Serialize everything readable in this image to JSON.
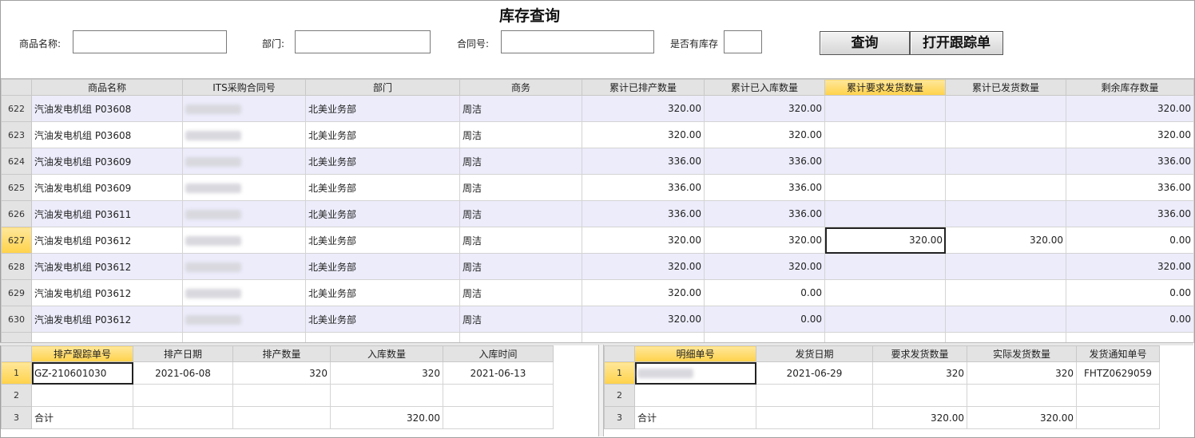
{
  "title": "库存查询",
  "form": {
    "product_label": "商品名称:",
    "product_value": "",
    "dept_label": "部门:",
    "dept_value": "",
    "contract_label": "合同号:",
    "contract_value": "",
    "stock_label": "是否有库存",
    "stock_value": ""
  },
  "buttons": {
    "query": "查询",
    "open_tracking": "打开跟踪单"
  },
  "main": {
    "headers": [
      "商品名称",
      "ITS采购合同号",
      "部门",
      "商务",
      "累计已排产数量",
      "累计已入库数量",
      "累计要求发货数量",
      "累计已发货数量",
      "剩余库存数量"
    ],
    "selected_header_index": 6,
    "selected_row": "627",
    "rows": [
      {
        "n": "622",
        "name": "汽油发电机组 P03608",
        "contract": "",
        "dept": "北美业务部",
        "biz": "周洁",
        "scheduled": "320.00",
        "stocked": "320.00",
        "req": "",
        "shipped": "",
        "remain": "320.00"
      },
      {
        "n": "623",
        "name": "汽油发电机组 P03608",
        "contract": "",
        "dept": "北美业务部",
        "biz": "周洁",
        "scheduled": "320.00",
        "stocked": "320.00",
        "req": "",
        "shipped": "",
        "remain": "320.00"
      },
      {
        "n": "624",
        "name": "汽油发电机组 P03609",
        "contract": "",
        "dept": "北美业务部",
        "biz": "周洁",
        "scheduled": "336.00",
        "stocked": "336.00",
        "req": "",
        "shipped": "",
        "remain": "336.00"
      },
      {
        "n": "625",
        "name": "汽油发电机组 P03609",
        "contract": "",
        "dept": "北美业务部",
        "biz": "周洁",
        "scheduled": "336.00",
        "stocked": "336.00",
        "req": "",
        "shipped": "",
        "remain": "336.00"
      },
      {
        "n": "626",
        "name": "汽油发电机组 P03611",
        "contract": "",
        "dept": "北美业务部",
        "biz": "周洁",
        "scheduled": "336.00",
        "stocked": "336.00",
        "req": "",
        "shipped": "",
        "remain": "336.00"
      },
      {
        "n": "627",
        "name": "汽油发电机组 P03612",
        "contract": "",
        "dept": "北美业务部",
        "biz": "周洁",
        "scheduled": "320.00",
        "stocked": "320.00",
        "req": "320.00",
        "shipped": "320.00",
        "remain": "0.00"
      },
      {
        "n": "628",
        "name": "汽油发电机组 P03612",
        "contract": "",
        "dept": "北美业务部",
        "biz": "周洁",
        "scheduled": "320.00",
        "stocked": "320.00",
        "req": "",
        "shipped": "",
        "remain": "320.00"
      },
      {
        "n": "629",
        "name": "汽油发电机组 P03612",
        "contract": "",
        "dept": "北美业务部",
        "biz": "周洁",
        "scheduled": "320.00",
        "stocked": "0.00",
        "req": "",
        "shipped": "",
        "remain": "0.00"
      },
      {
        "n": "630",
        "name": "汽油发电机组 P03612",
        "contract": "",
        "dept": "北美业务部",
        "biz": "周洁",
        "scheduled": "320.00",
        "stocked": "0.00",
        "req": "",
        "shipped": "",
        "remain": "0.00"
      }
    ]
  },
  "production": {
    "headers": [
      "排产跟踪单号",
      "排产日期",
      "排产数量",
      "入库数量",
      "入库时间"
    ],
    "rows": [
      {
        "n": "1",
        "c": [
          "GZ-210601030",
          "2021-06-08",
          "320",
          "320",
          "2021-06-13"
        ]
      },
      {
        "n": "2",
        "c": [
          "",
          "",
          "",
          "",
          ""
        ]
      },
      {
        "n": "3",
        "c": [
          "合计",
          "",
          "",
          "320.00",
          ""
        ]
      }
    ]
  },
  "shipping": {
    "headers": [
      "明细单号",
      "发货日期",
      "要求发货数量",
      "实际发货数量",
      "发货通知单号"
    ],
    "rows": [
      {
        "n": "1",
        "c": [
          "",
          "2021-06-29",
          "320",
          "320",
          "FHTZ0629059"
        ]
      },
      {
        "n": "2",
        "c": [
          "",
          "",
          "",
          "",
          ""
        ]
      },
      {
        "n": "3",
        "c": [
          "合计",
          "",
          "320.00",
          "320.00",
          ""
        ]
      }
    ]
  }
}
